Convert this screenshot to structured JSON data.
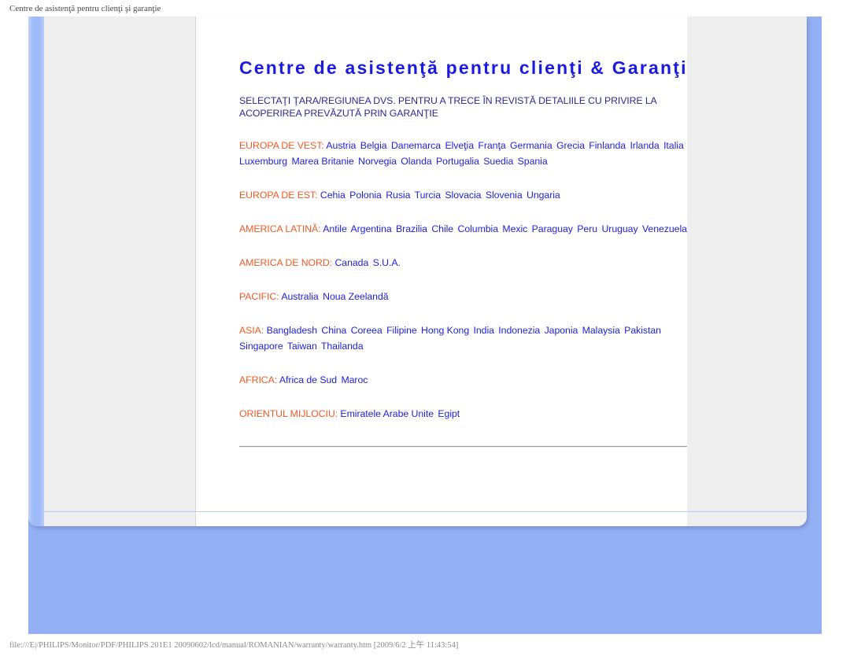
{
  "print_header": {
    "title": "Centre de asistenţă pentru clienţi şi garanţie"
  },
  "print_footer": {
    "path": "file:///E|/PHILIPS/Monitor/PDF/PHILIPS 201E1 20090602/lcd/manual/ROMANIAN/warranty/warranty.htm [2009/6/2 上午 11:43:54]"
  },
  "colors": {
    "page_background": "#94b0f4",
    "title_blue": "#1a1ae0",
    "link_blue": "#2222dd",
    "region_orange": "#f15a24",
    "panel_gray": "#eeeeee",
    "intro_blue": "#2a2a95"
  },
  "document": {
    "title": "Centre de asistenţă pentru clienţi & Garanţie",
    "intro": "SELECTAŢI ŢARA/REGIUNEA DVS. PENTRU A TRECE ÎN REVISTĂ DETALIILE CU PRIVIRE LA ACOPERIREA PREVĂZUTĂ PRIN GARANŢIE",
    "regions": [
      {
        "label": "EUROPA DE VEST:",
        "countries": [
          "Austria",
          "Belgia",
          "Danemarca",
          "Elveţia",
          "Franţa",
          "Germania",
          "Grecia",
          "Finlanda",
          "Irlanda",
          "Italia",
          "Luxemburg",
          "Marea Britanie",
          "Norvegia",
          "Olanda",
          "Portugalia",
          "Suedia",
          "Spania"
        ]
      },
      {
        "label": "EUROPA DE EST:",
        "countries": [
          "Cehia",
          "Polonia",
          "Rusia",
          "Turcia",
          "Slovacia",
          "Slovenia",
          "Ungaria"
        ]
      },
      {
        "label": "AMERICA LATINĂ:",
        "countries": [
          "Antile",
          "Argentina",
          "Brazilia",
          "Chile",
          "Columbia",
          "Mexic",
          "Paraguay",
          "Peru",
          "Uruguay",
          "Venezuela"
        ]
      },
      {
        "label": "AMERICA DE NORD:",
        "countries": [
          "Canada",
          "S.U.A."
        ]
      },
      {
        "label": "PACIFIC:",
        "countries": [
          "Australia",
          "Noua Zeelandă"
        ]
      },
      {
        "label": "ASIA:",
        "countries": [
          "Bangladesh",
          "China",
          "Coreea",
          "Filipine",
          "Hong Kong",
          "India",
          "Indonezia",
          "Japonia",
          "Malaysia",
          "Pakistan",
          "Singapore",
          "Taiwan",
          "Thailanda"
        ]
      },
      {
        "label": "AFRICA:",
        "countries": [
          "Africa de Sud",
          "Maroc"
        ]
      },
      {
        "label": "ORIENTUL MIJLOCIU:",
        "countries": [
          "Emiratele Arabe Unite",
          "Egipt"
        ]
      }
    ]
  }
}
